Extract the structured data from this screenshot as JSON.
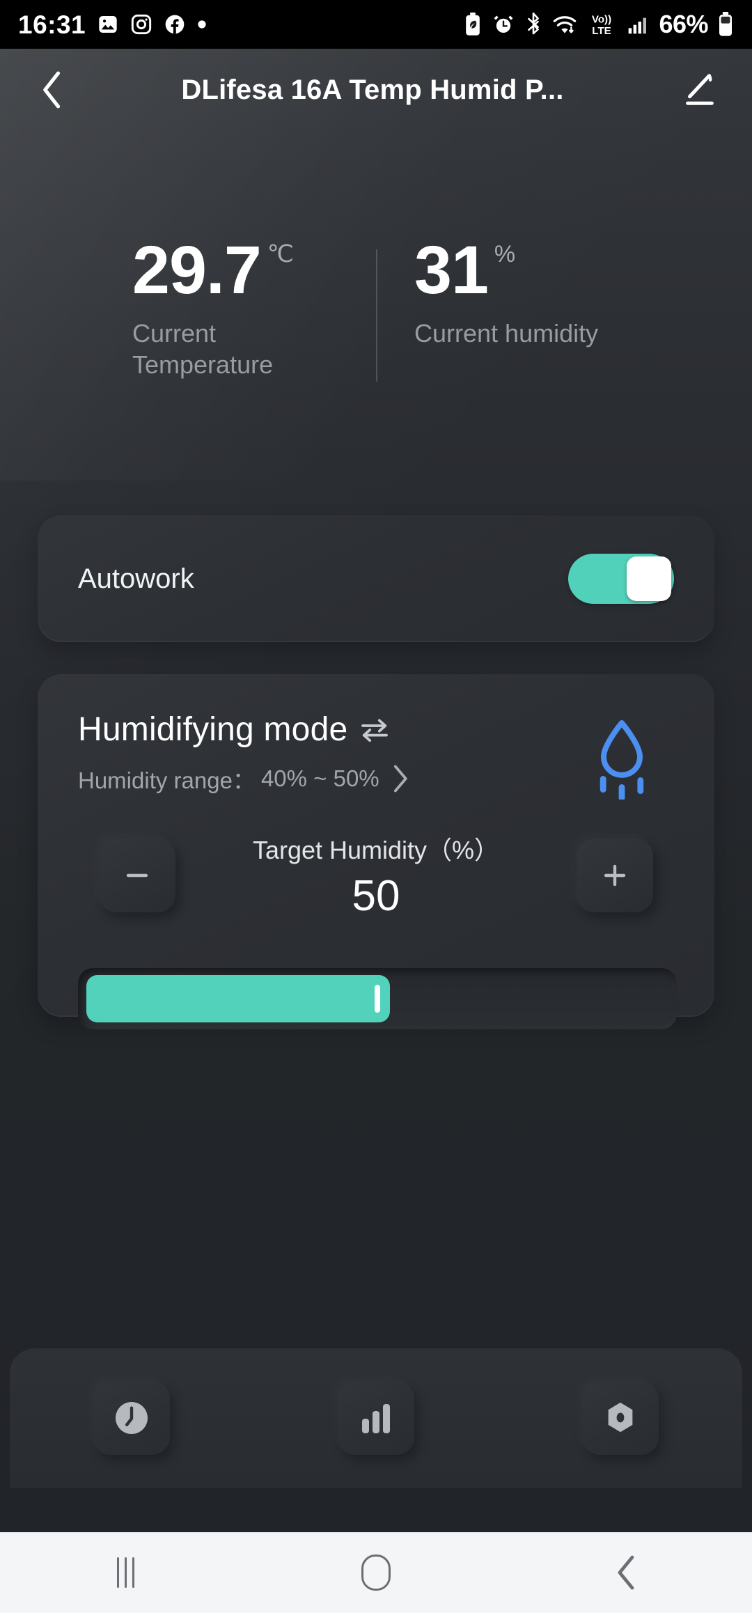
{
  "status_bar": {
    "time": "16:31",
    "left_icons": [
      "photos-icon",
      "instagram-icon",
      "facebook-icon",
      "dot-icon"
    ],
    "right_icons": [
      "battery-saver-icon",
      "alarm-icon",
      "bluetooth-icon",
      "wifi-icon",
      "volte-icon",
      "signal-icon"
    ],
    "volte_label_top": "Vo))",
    "volte_label_bottom": "LTE",
    "battery_percent": "66%"
  },
  "app_bar": {
    "back_icon": "chevron-left-icon",
    "title": "DLifesa 16A Temp Humid P...",
    "edit_icon": "pencil-edit-icon"
  },
  "readouts": [
    {
      "value": "29.7",
      "unit": "℃",
      "label": "Current Temperature",
      "name": "temperature"
    },
    {
      "value": "31",
      "unit": "%",
      "label": "Current humidity",
      "name": "humidity"
    }
  ],
  "autowork": {
    "label": "Autowork",
    "toggle_state": "on",
    "toggle_color": "#52d1ba"
  },
  "mode_card": {
    "title": "Humidifying mode",
    "swap_icon": "swap-arrows-icon",
    "range_label": "Humidity range：",
    "range_value": "40% ~ 50%",
    "range_chevron_icon": "chevron-right-icon",
    "mode_icon": "water-drop-icon",
    "mode_icon_color": "#4b8ff0",
    "target_label": "Target Humidity（%）",
    "target_value": "50",
    "minus_label": "−",
    "plus_label": "+",
    "slider": {
      "value": 50,
      "min": 0,
      "max": 100,
      "fill_percent": 51,
      "fill_color": "#53d2bb"
    }
  },
  "bottom_bar": {
    "items": [
      {
        "name": "timer",
        "icon": "clock-icon"
      },
      {
        "name": "statistics",
        "icon": "bar-chart-icon"
      },
      {
        "name": "settings",
        "icon": "hex-nut-icon"
      }
    ]
  },
  "nav_bar": {
    "recents_icon": "recents-icon",
    "home_icon": "home-icon",
    "back_icon": "back-chevron-icon"
  }
}
